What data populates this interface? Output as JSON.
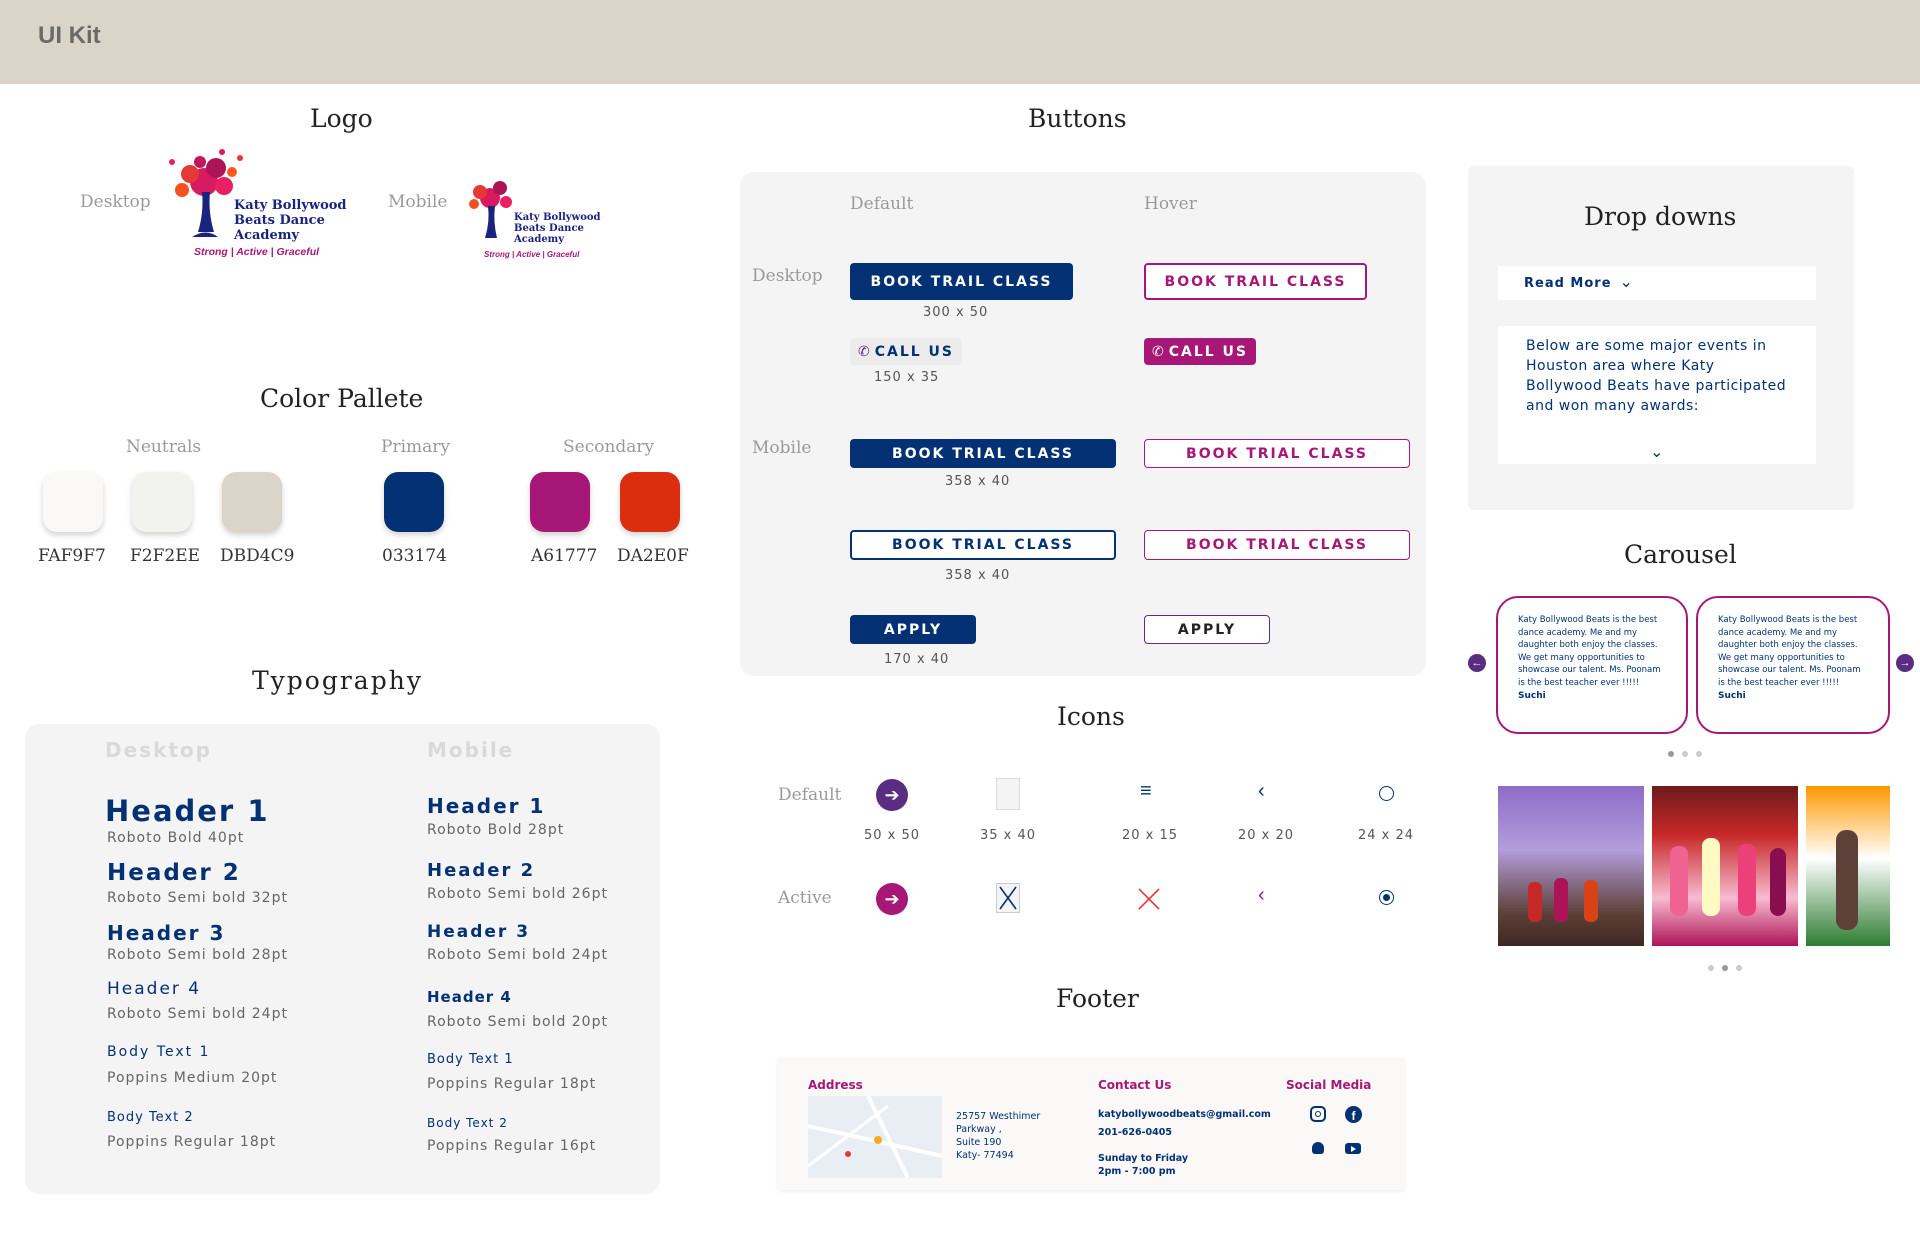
{
  "header": {
    "title": "UI Kit"
  },
  "logo": {
    "heading": "Logo",
    "desktop_label": "Desktop",
    "mobile_label": "Mobile",
    "brand_lines": [
      "Katy Bollywood",
      "Beats Dance",
      "Academy"
    ],
    "tagline": "Strong | Active | Graceful"
  },
  "palette": {
    "heading": "Color Pallete",
    "groups": [
      {
        "label": "Neutrals",
        "colors": [
          "#FAF9F7",
          "#F2F2EE",
          "#DBD4C9"
        ],
        "codes": [
          "FAF9F7",
          "F2F2EE",
          "DBD4C9"
        ]
      },
      {
        "label": "Primary",
        "colors": [
          "#033174"
        ],
        "codes": [
          "033174"
        ]
      },
      {
        "label": "Secondary",
        "colors": [
          "#A61777",
          "#DA2E0F"
        ],
        "codes": [
          "A61777",
          "DA2E0F"
        ]
      }
    ]
  },
  "typography": {
    "heading": "Typography",
    "desktop_label": "Desktop",
    "mobile_label": "Mobile",
    "desktop": [
      {
        "name": "Header 1",
        "spec": "Roboto Bold 40pt"
      },
      {
        "name": "Header 2",
        "spec": "Roboto Semi bold 32pt"
      },
      {
        "name": "Header 3",
        "spec": "Roboto Semi bold 28pt"
      },
      {
        "name": "Header 4",
        "spec": "Roboto Semi bold 24pt"
      },
      {
        "name": "Body Text 1",
        "spec": "Poppins Medium 20pt"
      },
      {
        "name": "Body Text 2",
        "spec": "Poppins Regular 18pt"
      }
    ],
    "mobile": [
      {
        "name": "Header 1",
        "spec": "Roboto Bold 28pt"
      },
      {
        "name": "Header 2",
        "spec": "Roboto Semi bold 26pt"
      },
      {
        "name": "Header 3",
        "spec": "Roboto Semi bold 24pt"
      },
      {
        "name": "Header 4",
        "spec": "Roboto Semi bold 20pt"
      },
      {
        "name": "Body Text 1",
        "spec": "Poppins Regular 18pt"
      },
      {
        "name": "Body Text 2",
        "spec": "Poppins Regular 16pt"
      }
    ]
  },
  "buttons": {
    "heading": "Buttons",
    "col_default": "Default",
    "col_hover": "Hover",
    "row_desktop": "Desktop",
    "row_mobile": "Mobile",
    "book_trail": "BOOK TRAIL CLASS",
    "book_trial": "BOOK TRIAL CLASS",
    "call_us": "CALL US",
    "apply": "APPLY",
    "dim_300": "300 x 50",
    "dim_150": "150 x 35",
    "dim_358a": "358 x 40",
    "dim_358b": "358 x 40",
    "dim_170": "170 x 40"
  },
  "dropdowns": {
    "heading": "Drop downs",
    "read_more": "Read More",
    "body": "Below are some major events in Houston area where Katy Bollywood Beats have participated and won many awards:"
  },
  "carousel": {
    "heading": "Carousel",
    "cards": [
      {
        "text": "Katy Bollywood Beats is the best dance academy. Me and my daughter both enjoy the classes. We get many opportunities to showcase our talent. Ms. Poonam is the best teacher ever !!!!!",
        "author": "Suchi"
      },
      {
        "text": "Katy Bollywood Beats is the best dance academy. Me and my daughter both enjoy the classes. We get many opportunities to showcase our talent. Ms. Poonam is the best teacher ever !!!!!",
        "author": "Suchi"
      }
    ]
  },
  "icons": {
    "heading": "Icons",
    "row_default": "Default",
    "row_active": "Active",
    "sizes": [
      "50 x 50",
      "35 x 40",
      "20 x 15",
      "20 x 20",
      "24 x 24"
    ]
  },
  "footer": {
    "heading": "Footer",
    "address_h": "Address",
    "address_lines": [
      "25757 Westhimer",
      "Parkway ,",
      "Suite 190",
      "Katy- 77494"
    ],
    "contact_h": "Contact Us",
    "email": "katybollywoodbeats@gmail.com",
    "phone": "201-626-0405",
    "hours_days": "Sunday to Friday",
    "hours_time": "2pm - 7:00 pm",
    "social_h": "Social Media"
  },
  "colors": {
    "navy": "#033174",
    "magenta": "#A61777",
    "red": "#DA2E0F",
    "purple": "#5A2D82"
  }
}
